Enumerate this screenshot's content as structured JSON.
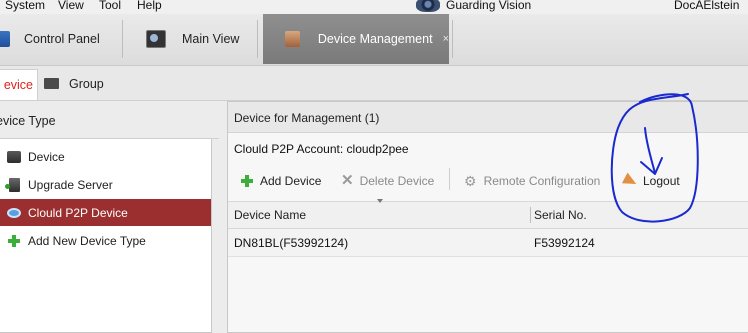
{
  "menubar": {
    "items": [
      "System",
      "View",
      "Tool",
      "Help"
    ],
    "brand": "Guarding Vision",
    "user": "DocAElstein"
  },
  "tabs": [
    {
      "label": "Control Panel",
      "icon": "control-panel-icon"
    },
    {
      "label": "Main View",
      "icon": "main-view-icon"
    },
    {
      "label": "Device Management",
      "icon": "device-management-icon",
      "active": true,
      "close": "×"
    }
  ],
  "subtabs": {
    "device": "evice",
    "group": "Group"
  },
  "left_panel": {
    "title": "evice Type",
    "items": [
      {
        "label": "Device",
        "icon": "device-icon"
      },
      {
        "label": "Upgrade Server",
        "icon": "upgrade-server-icon"
      },
      {
        "label": "Clould P2P Device",
        "icon": "cloud-icon",
        "selected": true
      },
      {
        "label": "Add New Device Type",
        "icon": "add-icon"
      }
    ]
  },
  "right_panel": {
    "title": "Device for Management (1)",
    "account_label": "Clould P2P Account:",
    "account_value": "cloudp2pee",
    "toolbar": {
      "add": "Add Device",
      "delete": "Delete Device",
      "remote": "Remote Configuration",
      "logout": "Logout"
    },
    "table": {
      "columns": [
        "Device Name",
        "Serial No."
      ],
      "rows": [
        [
          "DN81BL(F53992124)",
          "F53992124"
        ]
      ]
    }
  },
  "colors": {
    "selected_row": "#9b2f30",
    "active_tab": "#848484",
    "annotation": "#1a2ad0",
    "subtab_text": "#d9261c"
  }
}
